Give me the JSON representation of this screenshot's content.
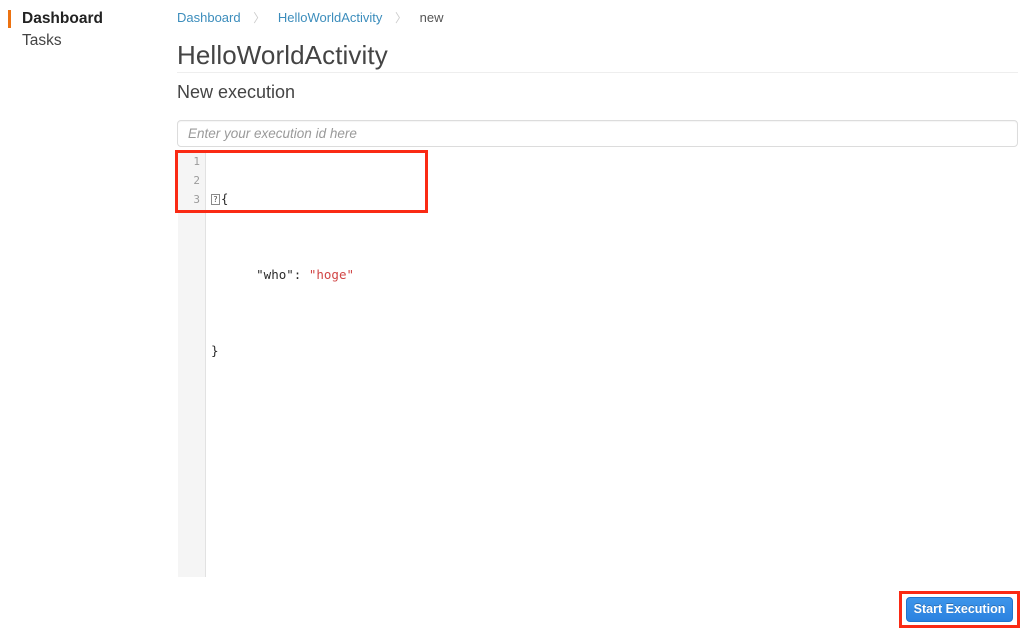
{
  "sidebar": {
    "items": [
      {
        "label": "Dashboard",
        "active": true
      },
      {
        "label": "Tasks",
        "active": false
      }
    ]
  },
  "breadcrumb": {
    "separator": "〉",
    "items": [
      {
        "label": "Dashboard",
        "type": "link"
      },
      {
        "label": "HelloWorldActivity",
        "type": "link"
      },
      {
        "label": "new",
        "type": "current"
      }
    ]
  },
  "main": {
    "page_title": "HelloWorldActivity",
    "section_subtitle": "New execution"
  },
  "execution_id": {
    "value": "",
    "placeholder": "Enter your execution id here"
  },
  "editor": {
    "language": "json",
    "gutter": [
      "1",
      "2",
      "3"
    ],
    "marker_glyph": "?",
    "lines": [
      {
        "number": "1",
        "marker": true,
        "text": "{"
      },
      {
        "number": "2",
        "marker": false,
        "key": "\"who\"",
        "colon": ": ",
        "value": "\"hoge\""
      },
      {
        "number": "3",
        "marker": false,
        "text": "}"
      }
    ],
    "raw_text": "{\n    \"who\": \"hoge\"\n}"
  },
  "actions": {
    "start_execution_label": "Start Execution"
  },
  "colors": {
    "accent_orange": "#ec7211",
    "link_blue": "#3c8dbc",
    "button_blue": "#2b82e0",
    "highlight_red": "#fa2a14",
    "string_red": "#d14545",
    "gutter_grey": "#f5f5f5"
  }
}
